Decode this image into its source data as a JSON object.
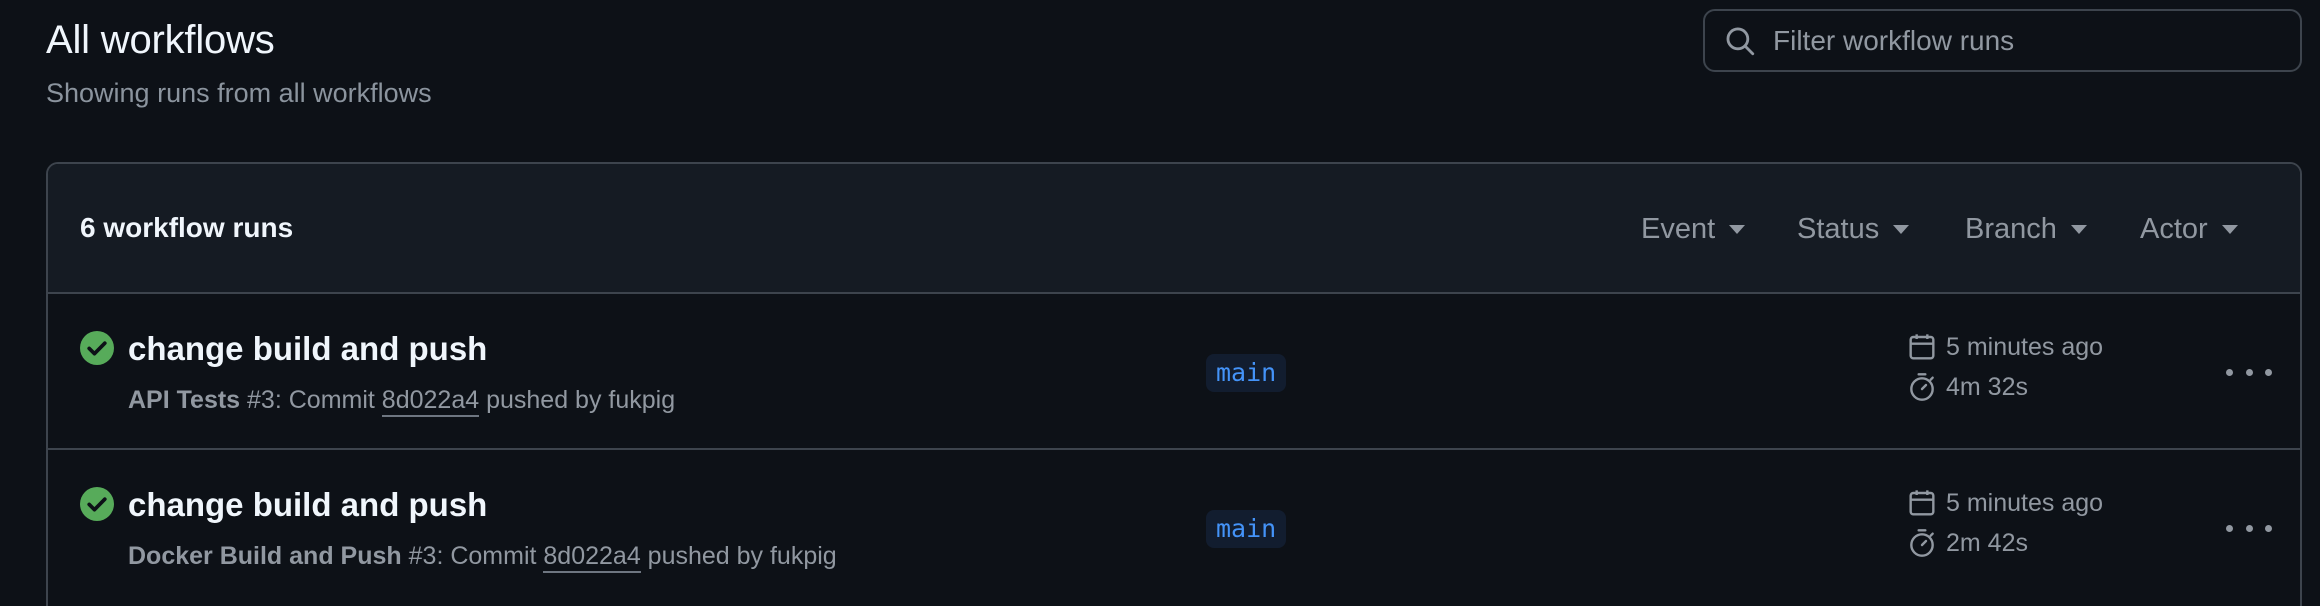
{
  "header": {
    "title": "All workflows",
    "subtitle": "Showing runs from all workflows"
  },
  "search": {
    "placeholder": "Filter workflow runs",
    "icon": "search-icon"
  },
  "runs_box": {
    "count_label": "6 workflow runs",
    "filters": [
      "Event",
      "Status",
      "Branch",
      "Actor"
    ]
  },
  "runs": [
    {
      "status": "success",
      "title": "change build and push",
      "workflow": "API Tests",
      "run_number": "#3",
      "commit_prefix": ": Commit",
      "sha": "8d022a4",
      "pushed_by": "pushed by fukpig",
      "branch": "main",
      "time_ago": "5 minutes ago",
      "duration": "4m 32s"
    },
    {
      "status": "success",
      "title": "change build and push",
      "workflow": "Docker Build and Push",
      "run_number": "#3",
      "commit_prefix": ": Commit",
      "sha": "8d022a4",
      "pushed_by": "pushed by fukpig",
      "branch": "main",
      "time_ago": "5 minutes ago",
      "duration": "2m 42s"
    }
  ],
  "colors": {
    "background": "#0d1117",
    "header_bg": "#151b23",
    "border": "#3d444d",
    "success": "#3fb950",
    "link": "#4493f8",
    "muted": "#9198a1"
  }
}
